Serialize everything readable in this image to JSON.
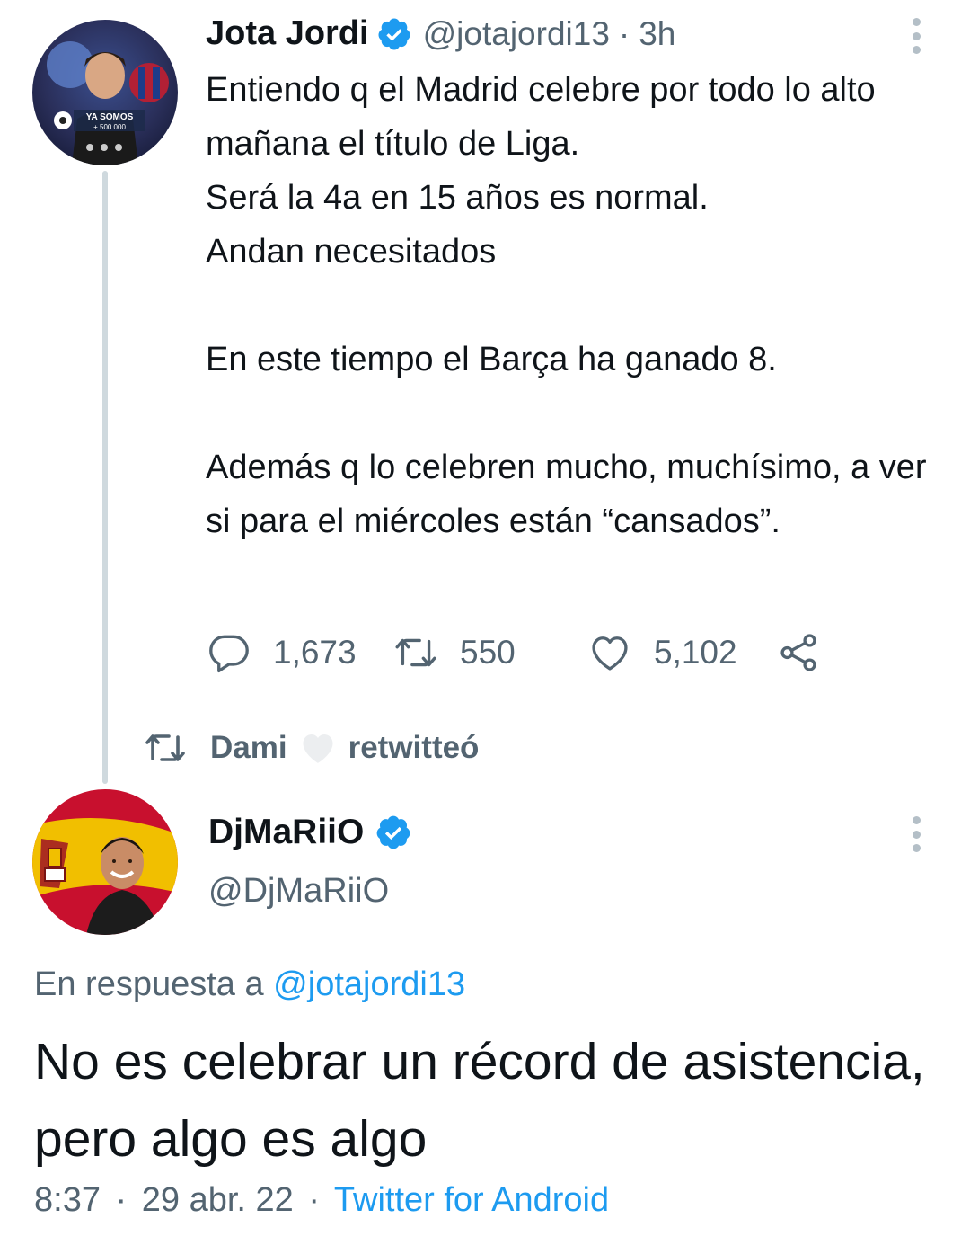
{
  "tweet1": {
    "display_name": "Jota Jordi",
    "handle": "@jotajordi13",
    "separator": "·",
    "time": "3h",
    "text_lines": [
      "Entiendo q el Madrid celebre por todo lo alto mañana el título de Liga.",
      "Será la 4a en 15 años es normal.",
      "Andan necesitados",
      "",
      "En este tiempo el Barça ha ganado 8.",
      "",
      "Además q lo celebren mucho, muchísimo, a ver si para el miércoles están “cansados”."
    ],
    "actions": {
      "replies": "1,673",
      "retweets": "550",
      "likes": "5,102"
    },
    "avatar": {
      "banner_text": "YA SOMOS",
      "banner_count": "+ 500.000"
    }
  },
  "retweet_banner": {
    "user": "Dami",
    "label": "retwitteó",
    "icon": "retweet-icon"
  },
  "tweet2": {
    "display_name": "DjMaRiiO",
    "handle": "@DjMaRiiO",
    "reply_prefix": "En respuesta a",
    "reply_to": "@jotajordi13",
    "text": "No es celebrar un récord de asistencia, pero algo es algo",
    "time": "8:37",
    "separator": "·",
    "date": "29 abr. 22",
    "source": "Twitter for Android"
  },
  "colors": {
    "text": "#0f1419",
    "secondary": "#536471",
    "accent": "#1d9bf0",
    "thread_line": "#cfd9de"
  }
}
